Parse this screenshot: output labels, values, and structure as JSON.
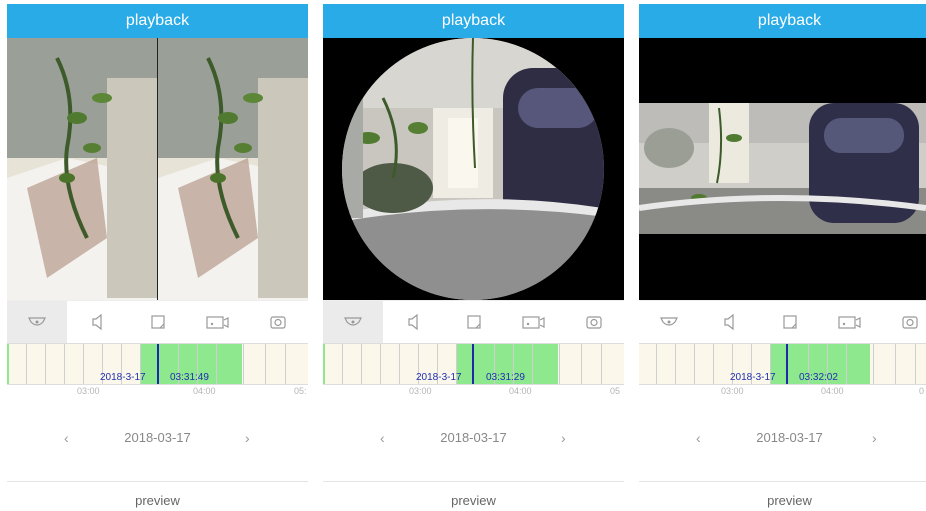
{
  "panels": [
    {
      "title": "playback",
      "view_mode": "double-panorama",
      "timeline": {
        "date_label": "2018-3-17",
        "time_label": "03:31:49",
        "ticks": [
          "03:00",
          "04:00",
          "05:"
        ]
      },
      "date_nav": {
        "prev_icon": "chevron-left",
        "date": "2018-03-17",
        "next_icon": "chevron-right"
      },
      "footer_label": "preview"
    },
    {
      "title": "playback",
      "view_mode": "fisheye-circle",
      "timeline": {
        "date_label": "2018-3-17",
        "time_label": "03:31:29",
        "ticks": [
          "03:00",
          "04:00",
          "05"
        ]
      },
      "date_nav": {
        "prev_icon": "chevron-left",
        "date": "2018-03-17",
        "next_icon": "chevron-right"
      },
      "footer_label": "preview"
    },
    {
      "title": "playback",
      "view_mode": "panorama-strip",
      "timeline": {
        "date_label": "2018-3-17",
        "time_label": "03:32:02",
        "ticks": [
          "03:00",
          "04:00",
          "0"
        ]
      },
      "date_nav": {
        "prev_icon": "chevron-left",
        "date": "2018-03-17",
        "next_icon": "chevron-right"
      },
      "footer_label": "preview"
    }
  ],
  "toolbar_icons": [
    "fisheye-view-icon",
    "audio-icon",
    "fullscreen-icon",
    "record-icon",
    "snapshot-icon"
  ],
  "colors": {
    "title_bar": "#29abe8",
    "record_segment": "#8ee88e",
    "cursor": "#1a2aa8",
    "timeline_bg": "#fbf7ea"
  }
}
